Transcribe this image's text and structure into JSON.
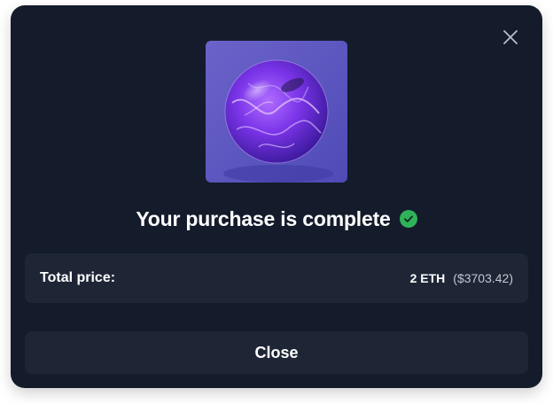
{
  "dialog": {
    "title": "Your purchase is complete",
    "status_icon": "check-circle-icon",
    "status_color": "#2fb35a",
    "close_icon": "close-icon",
    "image": "plasma-orb-nft"
  },
  "price": {
    "label": "Total price:",
    "eth": "2 ETH",
    "usd": "($3703.42)"
  },
  "actions": {
    "close_label": "Close"
  },
  "colors": {
    "modal_bg": "#141b2b",
    "panel_bg": "#1e2636",
    "text": "#ffffff",
    "muted_text": "#c2c7d0"
  }
}
